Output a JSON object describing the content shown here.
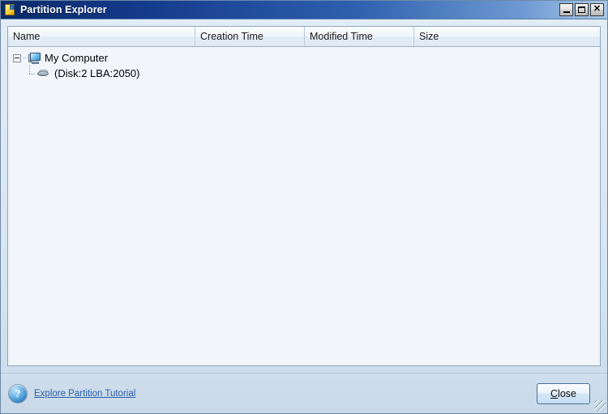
{
  "window": {
    "title": "Partition Explorer",
    "icon": "partition-document-icon",
    "buttons": {
      "minimize": "minimize-icon",
      "maximize": "maximize-icon",
      "close": "close-icon"
    }
  },
  "listview": {
    "columns": [
      {
        "label": "Name"
      },
      {
        "label": "Creation Time"
      },
      {
        "label": "Modified Time"
      },
      {
        "label": "Size"
      }
    ],
    "rows": [
      {
        "label": "My Computer",
        "icon": "computer-icon",
        "expanded": true,
        "creation_time": "",
        "modified_time": "",
        "size": ""
      },
      {
        "label": "(Disk:2 LBA:2050)",
        "icon": "disk-icon",
        "creation_time": "",
        "modified_time": "",
        "size": ""
      }
    ]
  },
  "footer": {
    "help_icon": "help-question-icon",
    "help_glyph": "?",
    "tutorial_link": "Explore Partition Tutorial",
    "close_label_prefix": "C",
    "close_label_rest": "lose",
    "resize_grip": "resize-grip-icon"
  },
  "colors": {
    "title_bar_start": "#0a2a66",
    "title_bar_end": "#a8c6e6",
    "window_bg": "#d5e3ef",
    "list_bg": "#f2f6fb",
    "footer_bg": "#cfdeec",
    "link": "#2b5fa8"
  }
}
